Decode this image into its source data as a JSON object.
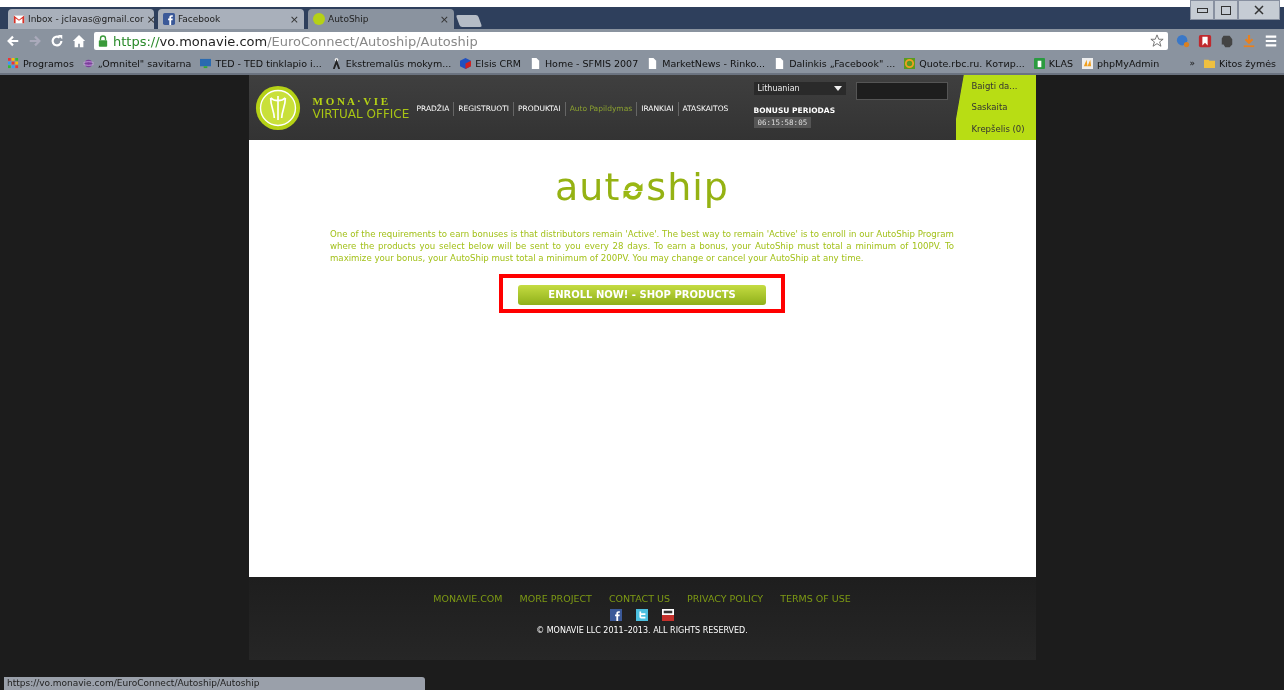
{
  "browser": {
    "tabs": [
      {
        "title": "Inbox - jclavas@gmail.cor",
        "kind": "mail",
        "selected": false
      },
      {
        "title": "Facebook",
        "kind": "facebook",
        "selected": false
      },
      {
        "title": "AutoShip",
        "kind": "site",
        "selected": true
      }
    ],
    "close_glyph": "×",
    "url": {
      "scheme": "https://",
      "host": "vo.monavie.com",
      "path": "/EuroConnect/Autoship/Autoship"
    },
    "bookmarks": [
      {
        "label": "Programos",
        "kind": "apps"
      },
      {
        "label": "„Omnitel\" savitarna",
        "kind": "planet"
      },
      {
        "label": "TED - TED tinklapio i...",
        "kind": "monitor"
      },
      {
        "label": "Ekstremalūs mokym...",
        "kind": "figure"
      },
      {
        "label": "Elsis CRM",
        "kind": "cube"
      },
      {
        "label": "Home - SFMIS 2007",
        "kind": "page"
      },
      {
        "label": "MarketNews - Rinko...",
        "kind": "page"
      },
      {
        "label": "Dalinkis „Facebook\" ...",
        "kind": "page"
      },
      {
        "label": "Quote.rbc.ru. Котир...",
        "kind": "quote"
      },
      {
        "label": "KLAS",
        "kind": "klas"
      },
      {
        "label": "phpMyAdmin",
        "kind": "pma"
      }
    ],
    "more_bookmarks": "»",
    "other_bookmarks": "Kitos žymės",
    "status_url": "https://vo.monavie.com/EuroConnect/Autoship/Autoship"
  },
  "site": {
    "brand": "M O N A · V I E",
    "brand_sub": "VIRTUAL OFFICE",
    "nav": [
      {
        "label": "PRADŽIA",
        "selected": false
      },
      {
        "label": "REGISTRUOTI",
        "selected": false
      },
      {
        "label": "PRODUKTAI",
        "selected": false
      },
      {
        "label": "Auto Papildymas",
        "selected": true
      },
      {
        "label": "IRANKIAI",
        "selected": false
      },
      {
        "label": "ATASKAITOS",
        "selected": false
      }
    ],
    "language": "Lithuanian",
    "bonus_label": "BONUSU PERIODAS",
    "bonus_timer": "06:15:58:05",
    "side_links": [
      "Baigti da...",
      "Saskaita",
      "Krepšelis (0)"
    ],
    "logo_left": "aut",
    "logo_right": "ship",
    "intro": "One of the requirements to earn bonuses is that distributors remain 'Active'. The best way to remain 'Active' is to enroll in our AutoShip Program where the products you select below will be sent to you every 28 days. To earn a bonus, your AutoShip must total a minimum of 100PV. To maximize your bonus, your AutoShip must total a minimum of 200PV. You may change or cancel your AutoShip at any time.",
    "enroll_button": "ENROLL NOW! - SHOP PRODUCTS",
    "footer_links": [
      "MONAVIE.COM",
      "MORE PROJECT",
      "CONTACT US",
      "PRIVACY POLICY",
      "TERMS OF USE"
    ],
    "social": [
      {
        "kind": "facebook"
      },
      {
        "kind": "twitter"
      },
      {
        "kind": "youtube"
      }
    ],
    "copyright": "© MONAVIE LLC 2011–2013. ALL RIGHTS RESERVED."
  }
}
